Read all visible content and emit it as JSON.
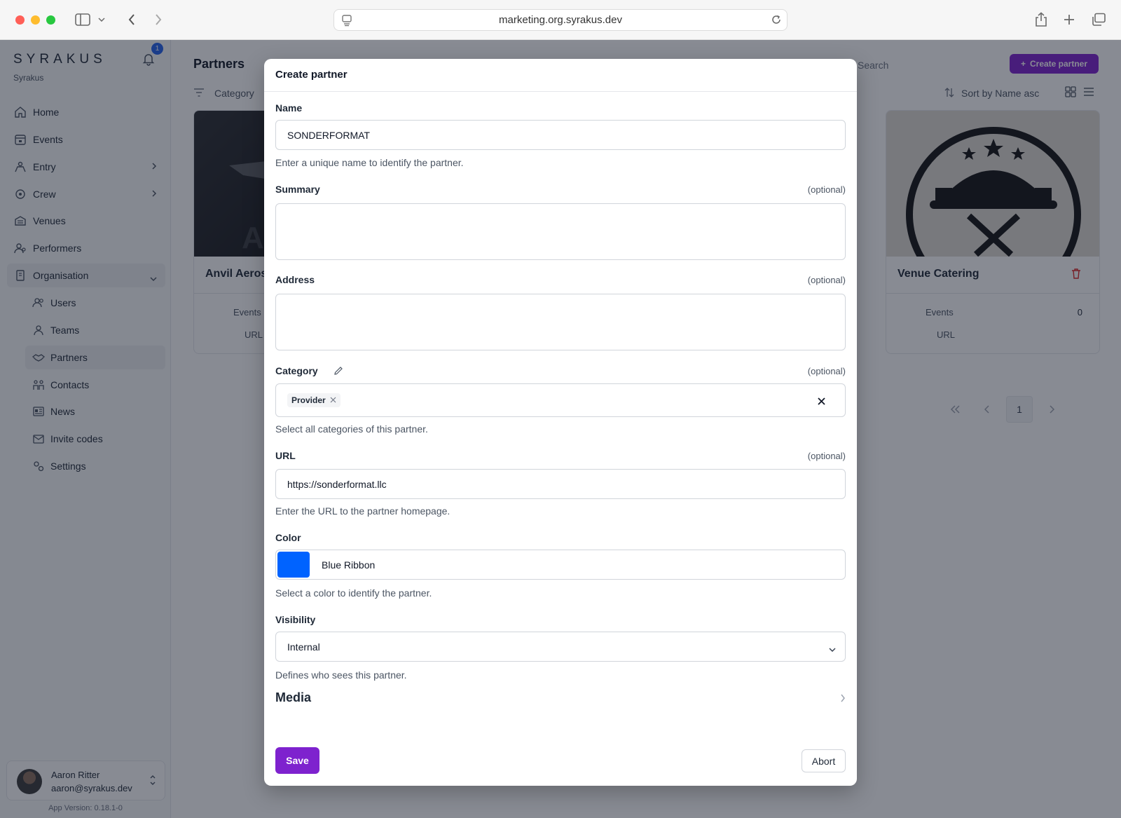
{
  "browser": {
    "url": "marketing.org.syrakus.dev"
  },
  "sidebar": {
    "logo": "SYRAKUS",
    "org_name": "Syrakus",
    "notification_count": "1",
    "items": [
      {
        "label": "Home",
        "icon": "home-icon"
      },
      {
        "label": "Events",
        "icon": "calendar-icon"
      },
      {
        "label": "Entry",
        "icon": "entry-icon"
      },
      {
        "label": "Crew",
        "icon": "crew-icon"
      },
      {
        "label": "Venues",
        "icon": "venue-icon"
      },
      {
        "label": "Performers",
        "icon": "performer-icon"
      },
      {
        "label": "Organisation",
        "icon": "building-icon"
      }
    ],
    "sub_items": [
      {
        "label": "Users",
        "icon": "users-icon"
      },
      {
        "label": "Teams",
        "icon": "team-icon"
      },
      {
        "label": "Partners",
        "icon": "handshake-icon"
      },
      {
        "label": "Contacts",
        "icon": "contacts-icon"
      },
      {
        "label": "News",
        "icon": "news-icon"
      },
      {
        "label": "Invite codes",
        "icon": "envelope-icon"
      },
      {
        "label": "Settings",
        "icon": "settings-icon"
      }
    ],
    "user": {
      "name": "Aaron Ritter",
      "email": "aaron@syrakus.dev"
    },
    "app_version": "App Version: 0.18.1-0"
  },
  "main": {
    "title": "Partners",
    "search_placeholder": "Search",
    "create_label": "Create partner",
    "filter_label": "Category",
    "sort_label": "Sort by Name asc",
    "cards": [
      {
        "title": "Anvil Aerosp",
        "events_label": "Events",
        "url_label": "URL"
      },
      {
        "title": "Venue Catering",
        "events_label": "Events",
        "events_value": "0",
        "url_label": "URL"
      }
    ],
    "pager": {
      "current_page": "1"
    }
  },
  "modal": {
    "title": "Create partner",
    "optional_text": "(optional)",
    "name": {
      "label": "Name",
      "value": "SONDERFORMAT",
      "help": "Enter a unique name to identify the partner."
    },
    "summary": {
      "label": "Summary",
      "value": ""
    },
    "address": {
      "label": "Address",
      "value": ""
    },
    "category": {
      "label": "Category",
      "chip": "Provider",
      "help": "Select all categories of this partner."
    },
    "url": {
      "label": "URL",
      "value": "https://sonderformat.llc",
      "help": "Enter the URL to the partner homepage."
    },
    "color": {
      "label": "Color",
      "name": "Blue Ribbon",
      "hex": "#0063FF",
      "help": "Select a color to identify the partner."
    },
    "visibility": {
      "label": "Visibility",
      "value": "Internal",
      "help": "Defines who sees this partner."
    },
    "media": {
      "label": "Media"
    },
    "save_label": "Save",
    "abort_label": "Abort"
  },
  "colors": {
    "accent": "#7E22CE",
    "selected_color": "#0063FF",
    "notification_badge": "#2563EB"
  }
}
